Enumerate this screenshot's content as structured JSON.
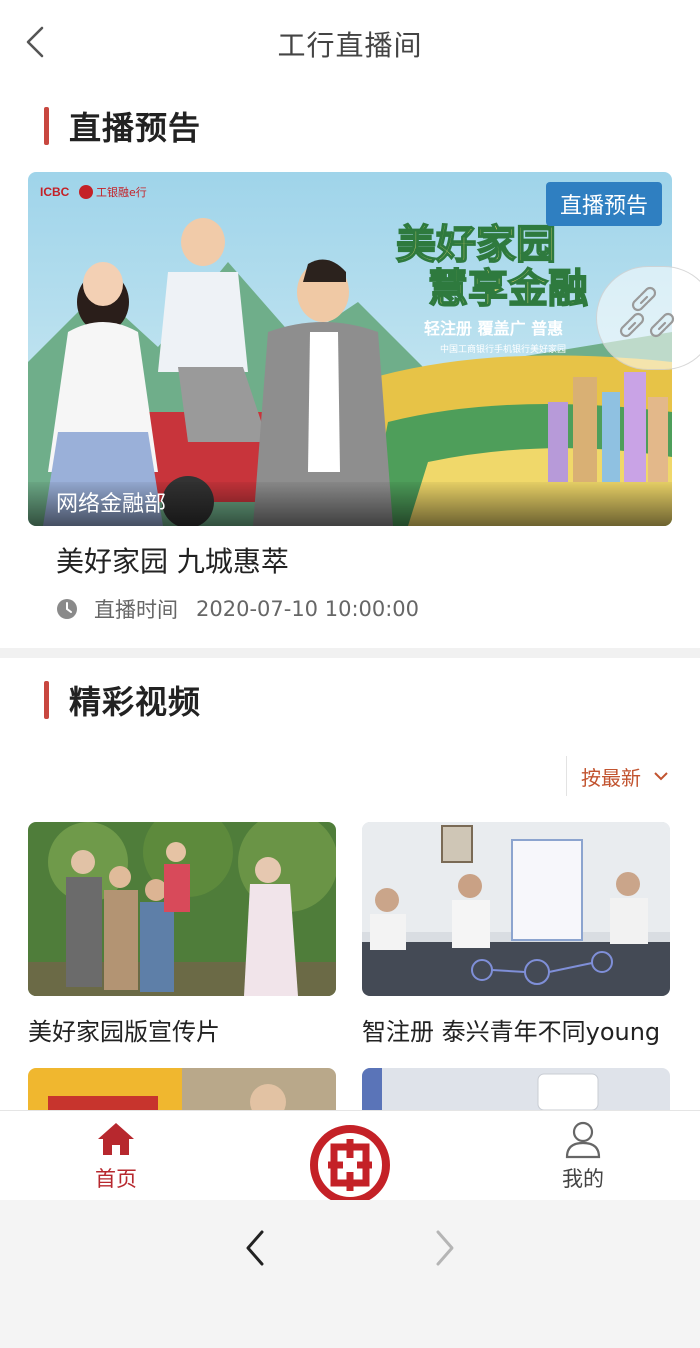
{
  "header": {
    "title": "工行直播间"
  },
  "live_section": {
    "heading": "直播预告",
    "card": {
      "badge": "直播预告",
      "banner_brand": "ICBC",
      "banner_brand_cn": "工银融e行",
      "banner_title_line1": "美好家园",
      "banner_title_line2": "慧享金融",
      "banner_tagline": "轻注册  覆盖广  普惠",
      "banner_sub": "中国工商银行手机银行美好家园",
      "department": "网络金融部",
      "title": "美好家园 九城惠萃",
      "time_label": "直播时间",
      "time_value": "2020-07-10 10:00:00"
    }
  },
  "video_section": {
    "heading": "精彩视频",
    "sort_label": "按最新",
    "videos": [
      {
        "title": "美好家园版宣传片"
      },
      {
        "title": "智注册 泰兴青年不同young"
      }
    ]
  },
  "tabbar": {
    "home_label": "首页",
    "mine_label": "我的"
  },
  "colors": {
    "accent": "#b7282e",
    "badge_blue": "#2f7fc1",
    "sort_orange": "#c25430"
  }
}
